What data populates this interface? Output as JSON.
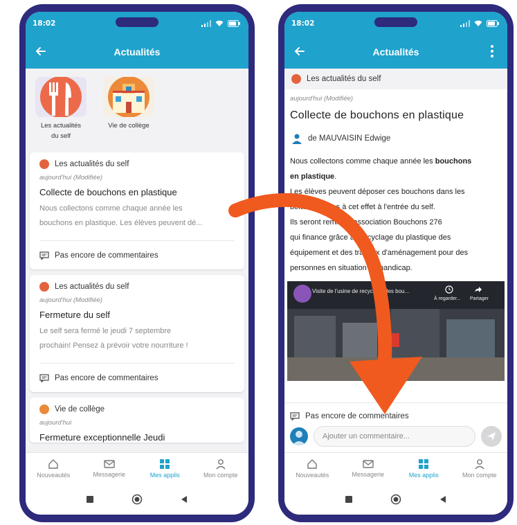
{
  "status": {
    "time": "18:02"
  },
  "left": {
    "title": "Actualités",
    "apps": [
      {
        "label_line1": "Les actualités",
        "label_line2": "du self"
      },
      {
        "label_line1": "Vie de collège",
        "label_line2": ""
      }
    ],
    "cards": [
      {
        "source": "Les actualités du self",
        "date": "aujourd'hui (Modifiée)",
        "title": "Collecte de bouchons en plastique",
        "excerpt_line1": "Nous collectons comme chaque année les",
        "excerpt_line2": "bouchons en plastique. Les élèves peuvent dé...",
        "comments": "Pas encore de commentaires"
      },
      {
        "source": "Les actualités du self",
        "date": "aujourd'hui (Modifiée)",
        "title": "Fermeture du self",
        "excerpt_line1": "Le self sera fermé le jeudi 7 septembre",
        "excerpt_line2": "prochain! Pensez à prévoir votre nourriture !",
        "comments": "Pas encore de commentaires"
      },
      {
        "source": "Vie de collège",
        "date": "aujourd'hui",
        "title": "Fermeture exceptionnelle Jeudi"
      }
    ]
  },
  "right": {
    "title": "Actualités",
    "source": "Les actualités du self",
    "date": "aujourd'hui (Modifiée)",
    "article_title": "Collecte de bouchons en plastique",
    "author": "de MAUVAISIN Edwige",
    "body": {
      "l1_plain": "Nous collectons comme chaque année les ",
      "l1_bold": "bouchons",
      "l2_bold": "en plastique",
      "l2_plain": ".",
      "l3": " Les élèves peuvent déposer ces bouchons dans les",
      "l4": "boîtes prévues à cet effet à l'entrée du self.",
      "l5": "Ils seront remis à l'association Bouchons 276",
      "l6": "qui finance grâce au recyclage du plastique des",
      "l7": "équipement et des travaux d'aménagement pour des",
      "l8": "personnes en situation de handicap."
    },
    "video": {
      "title": "Visite de l'usine de recyclage des bou...",
      "watch_later": "À regarder...",
      "share": "Partager"
    },
    "comments": "Pas encore de commentaires",
    "comment_placeholder": "Ajouter un commentaire..."
  },
  "nav": [
    {
      "label": "Nouveautés",
      "icon": "house-icon"
    },
    {
      "label": "Messagerie",
      "icon": "mail-icon"
    },
    {
      "label": "Mes applis",
      "icon": "grid-icon",
      "active": true
    },
    {
      "label": "Mon compte",
      "icon": "user-icon"
    }
  ],
  "colors": {
    "primary": "#1fa2cc",
    "frame": "#2e2a7c",
    "arrow": "#f05a1e",
    "self": "#e4633f"
  }
}
